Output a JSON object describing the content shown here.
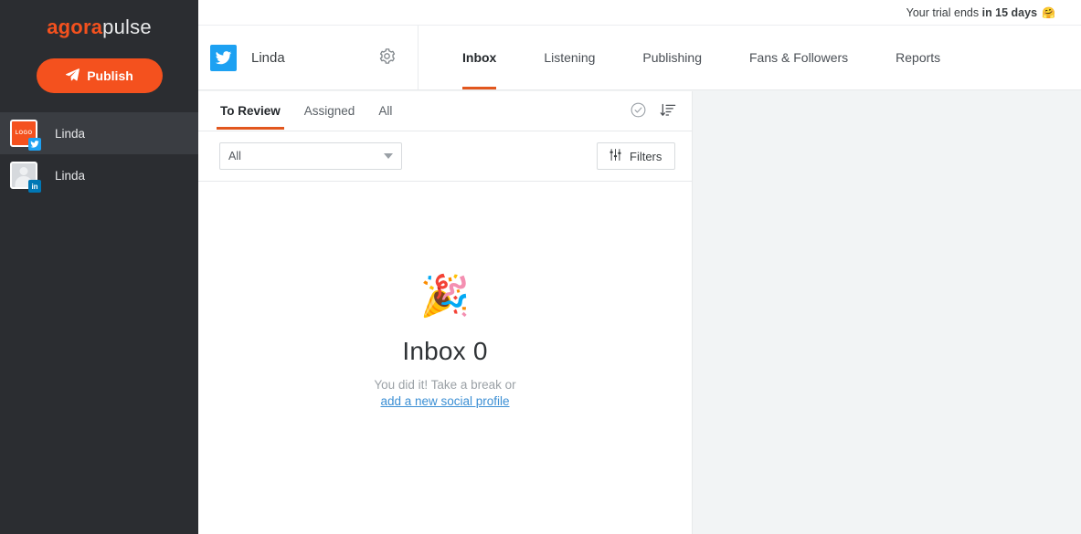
{
  "brand": {
    "part1": "agora",
    "part2": "pulse"
  },
  "sidebar": {
    "publish_label": "Publish",
    "publish_icon": "paper-plane-icon",
    "profiles": [
      {
        "name": "Linda",
        "network": "twitter",
        "avatar_type": "logo",
        "avatar_text": "LOGO",
        "active": true
      },
      {
        "name": "Linda",
        "network": "linkedin",
        "avatar_type": "person",
        "badge_text": "in",
        "active": false
      }
    ]
  },
  "topbar": {
    "trial_prefix": "Your trial ends ",
    "trial_strong": "in 15 days",
    "trial_emoji": "🤗"
  },
  "header": {
    "profile_name": "Linda",
    "network_icon": "twitter-icon",
    "settings_icon": "gear-icon",
    "tabs": [
      {
        "label": "Inbox",
        "active": true
      },
      {
        "label": "Listening",
        "active": false
      },
      {
        "label": "Publishing",
        "active": false
      },
      {
        "label": "Fans & Followers",
        "active": false
      },
      {
        "label": "Reports",
        "active": false
      }
    ]
  },
  "panel": {
    "tabs": [
      {
        "label": "To Review",
        "active": true
      },
      {
        "label": "Assigned",
        "active": false
      },
      {
        "label": "All",
        "active": false
      }
    ],
    "tools": [
      {
        "icon": "check-circle-icon"
      },
      {
        "icon": "sort-descending-icon"
      }
    ],
    "filter_select_value": "All",
    "filters_label": "Filters",
    "filters_icon": "sliders-icon",
    "empty_state": {
      "emoji": "🎉",
      "title": "Inbox 0",
      "subtitle": "You did it! Take a break or",
      "link": "add a new social profile"
    }
  },
  "colors": {
    "accent_orange": "#f4511e",
    "tab_underline": "#e2571e",
    "sidebar_bg": "#2b2d31",
    "twitter_blue": "#1da1f2",
    "linkedin_blue": "#0077b5",
    "link_blue": "#3b8fd4",
    "page_bg": "#f2f4f5"
  }
}
